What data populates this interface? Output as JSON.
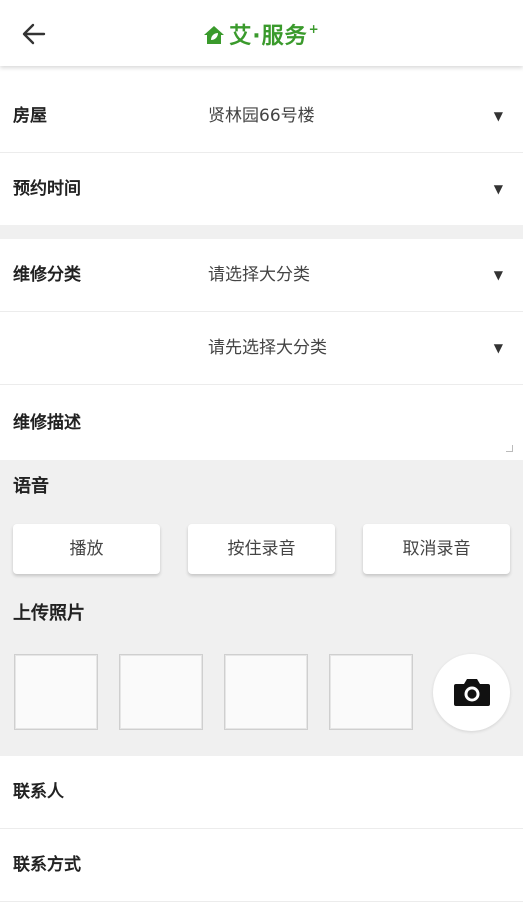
{
  "header": {
    "back_icon": "arrow-left-icon",
    "logo_text": "艾·服务",
    "logo_sup": "+",
    "brand_color": "#3a9a2c"
  },
  "form": {
    "house": {
      "label": "房屋",
      "value": "贤林园66号楼",
      "caret": "▼"
    },
    "appointment": {
      "label": "预约时间",
      "value": "",
      "caret": "▼"
    },
    "category": {
      "label": "维修分类",
      "value": "请选择大分类",
      "caret": "▼"
    },
    "subcategory": {
      "label": "",
      "value": "请先选择大分类",
      "caret": "▼"
    },
    "description": {
      "label": "维修描述",
      "value": ""
    }
  },
  "voice": {
    "title": "语音",
    "play_label": "播放",
    "record_label": "按住录音",
    "cancel_label": "取消录音"
  },
  "photos": {
    "title": "上传照片",
    "camera_icon": "camera-icon"
  },
  "contact": {
    "name_label": "联系人",
    "phone_label": "联系方式"
  }
}
